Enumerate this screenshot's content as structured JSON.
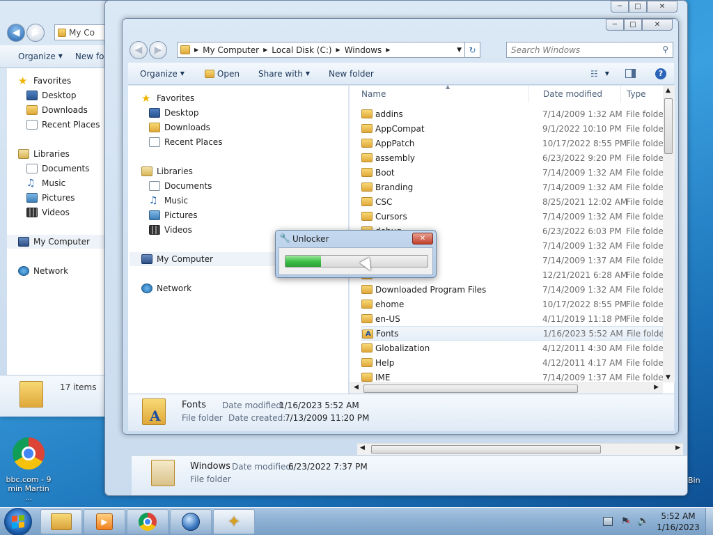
{
  "desktop": {
    "icons": [
      {
        "label_line1": "bbc.com - 9",
        "label_line2": "min Martin ..."
      },
      {
        "label": "Bin"
      }
    ]
  },
  "back_window": {
    "address": "My Co",
    "commands": {
      "organize": "Organize",
      "new_folder": "New fol"
    },
    "favorites_label": "Favorites",
    "favorites": [
      "Desktop",
      "Downloads",
      "Recent Places"
    ],
    "libraries_label": "Libraries",
    "libraries": [
      "Documents",
      "Music",
      "Pictures",
      "Videos"
    ],
    "computer": "My Computer",
    "network": "Network",
    "item_count": "17 items"
  },
  "mid_window": {
    "details_name": "Windows",
    "details_modified_label": "Date modified:",
    "details_modified": "6/23/2022 7:37 PM",
    "details_type": "File folder"
  },
  "front_window": {
    "breadcrumb": [
      "My Computer",
      "Local Disk (C:)",
      "Windows"
    ],
    "search_placeholder": "Search Windows",
    "commands": {
      "organize": "Organize",
      "open": "Open",
      "share_with": "Share with",
      "new_folder": "New folder"
    },
    "nav": {
      "favorites_label": "Favorites",
      "favorites": [
        "Desktop",
        "Downloads",
        "Recent Places"
      ],
      "libraries_label": "Libraries",
      "libraries": [
        "Documents",
        "Music",
        "Pictures",
        "Videos"
      ],
      "computer": "My Computer",
      "network": "Network"
    },
    "columns": {
      "name": "Name",
      "date": "Date modified",
      "type": "Type"
    },
    "files": [
      {
        "name": "addins",
        "date": "7/14/2009 1:32 AM",
        "type": "File folder"
      },
      {
        "name": "AppCompat",
        "date": "9/1/2022 10:10 PM",
        "type": "File folder"
      },
      {
        "name": "AppPatch",
        "date": "10/17/2022 8:55 PM",
        "type": "File folder"
      },
      {
        "name": "assembly",
        "date": "6/23/2022 9:20 PM",
        "type": "File folder"
      },
      {
        "name": "Boot",
        "date": "7/14/2009 1:32 AM",
        "type": "File folder"
      },
      {
        "name": "Branding",
        "date": "7/14/2009 1:32 AM",
        "type": "File folder"
      },
      {
        "name": "CSC",
        "date": "8/25/2021 12:02 AM",
        "type": "File folder"
      },
      {
        "name": "Cursors",
        "date": "7/14/2009 1:32 AM",
        "type": "File folder"
      },
      {
        "name": "debug",
        "date": "6/23/2022 6:03 PM",
        "type": "File folder"
      },
      {
        "name": "",
        "date": "7/14/2009 1:32 AM",
        "type": "File folder"
      },
      {
        "name": "",
        "date": "7/14/2009 1:37 AM",
        "type": "File folder"
      },
      {
        "name": "",
        "date": "12/21/2021 6:28 AM",
        "type": "File folder"
      },
      {
        "name": "Downloaded Program Files",
        "date": "7/14/2009 1:32 AM",
        "type": "File folder"
      },
      {
        "name": "ehome",
        "date": "10/17/2022 8:55 PM",
        "type": "File folder"
      },
      {
        "name": "en-US",
        "date": "4/11/2019 11:18 PM",
        "type": "File folder"
      },
      {
        "name": "Fonts",
        "date": "1/16/2023 5:52 AM",
        "type": "File folder"
      },
      {
        "name": "Globalization",
        "date": "4/12/2011 4:30 AM",
        "type": "File folder"
      },
      {
        "name": "Help",
        "date": "4/12/2011 4:17 AM",
        "type": "File folder"
      },
      {
        "name": "IME",
        "date": "7/14/2009 1:37 AM",
        "type": "File folder"
      }
    ],
    "selected_index": 15,
    "details": {
      "name": "Fonts",
      "modified_label": "Date modified:",
      "modified": "1/16/2023 5:52 AM",
      "type": "File folder",
      "created_label": "Date created:",
      "created": "7/13/2009 11:20 PM"
    }
  },
  "unlocker": {
    "title": "Unlocker",
    "progress": 0.25,
    "progress_color": "#3fc24a"
  },
  "taskbar": {
    "time": "5:52 AM",
    "date": "1/16/2023"
  },
  "colors": {
    "accent": "#1e395b",
    "selection": "#e5eef8"
  }
}
